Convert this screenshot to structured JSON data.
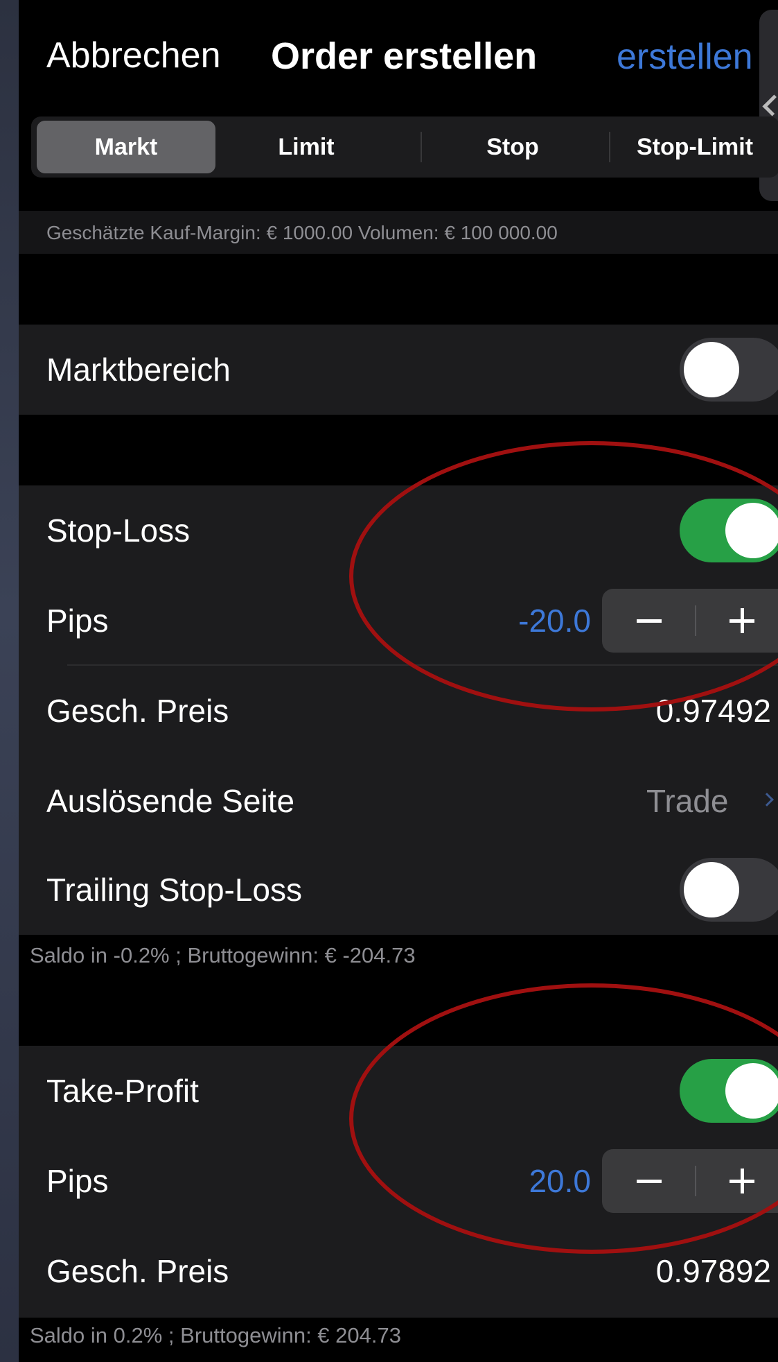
{
  "nav": {
    "cancel": "Abbrechen",
    "title": "Order erstellen",
    "create": "erstellen"
  },
  "order_types": {
    "items": [
      "Markt",
      "Limit",
      "Stop",
      "Stop-Limit"
    ],
    "selected": "Markt"
  },
  "info": "Geschätzte Kauf-Margin: € 1000.00   Volumen: € 100 000.00",
  "market_range": {
    "label": "Marktbereich",
    "enabled": false
  },
  "stop_loss": {
    "label": "Stop-Loss",
    "enabled": true,
    "pips_label": "Pips",
    "pips_value": "-20.0",
    "price_label": "Gesch. Preis",
    "price_value": "0.97492",
    "trigger_label": "Auslösende Seite",
    "trigger_value": "Trade",
    "trailing_label": "Trailing Stop-Loss",
    "trailing_enabled": false,
    "footnote": "Saldo in -0.2% ; Bruttogewinn: € -204.73"
  },
  "take_profit": {
    "label": "Take-Profit",
    "enabled": true,
    "pips_label": "Pips",
    "pips_value": "20.0",
    "price_label": "Gesch. Preis",
    "price_value": "0.97892",
    "footnote": "Saldo in 0.2% ; Bruttogewinn: € 204.73"
  },
  "colors": {
    "accent_blue": "#3d78d8",
    "toggle_on": "#27a046",
    "annotation_red": "#a01010"
  }
}
